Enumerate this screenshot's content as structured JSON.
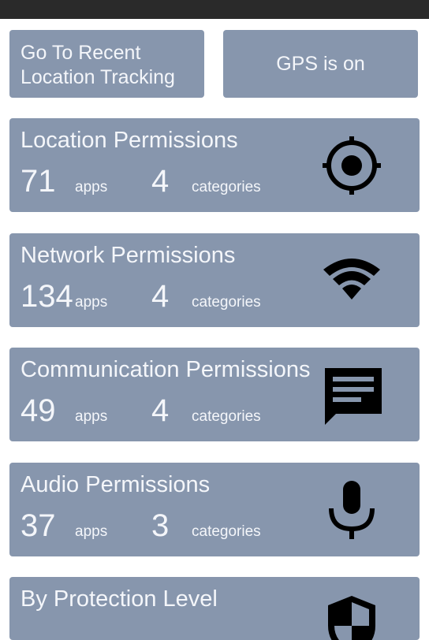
{
  "top_buttons": {
    "recent_line1": "Go To Recent",
    "recent_line2": "Location Tracking",
    "gps": "GPS is on"
  },
  "cards": [
    {
      "title": "Location Permissions",
      "apps_count": "71",
      "apps_label": "apps",
      "categories_count": "4",
      "categories_label": "categories",
      "icon": "gps-target-icon"
    },
    {
      "title": "Network Permissions",
      "apps_count": "134",
      "apps_label": "apps",
      "categories_count": "4",
      "categories_label": "categories",
      "icon": "wifi-icon"
    },
    {
      "title": "Communication Permissions",
      "apps_count": "49",
      "apps_label": "apps",
      "categories_count": "4",
      "categories_label": "categories",
      "icon": "message-icon"
    },
    {
      "title": "Audio Permissions",
      "apps_count": "37",
      "apps_label": "apps",
      "categories_count": "3",
      "categories_label": "categories",
      "icon": "microphone-icon"
    },
    {
      "title": "By Protection Level",
      "icon": "shield-icon"
    }
  ],
  "colors": {
    "card_background": "#8796ad",
    "text": "#f4f6fa",
    "status_bar": "#2a2a2a"
  }
}
